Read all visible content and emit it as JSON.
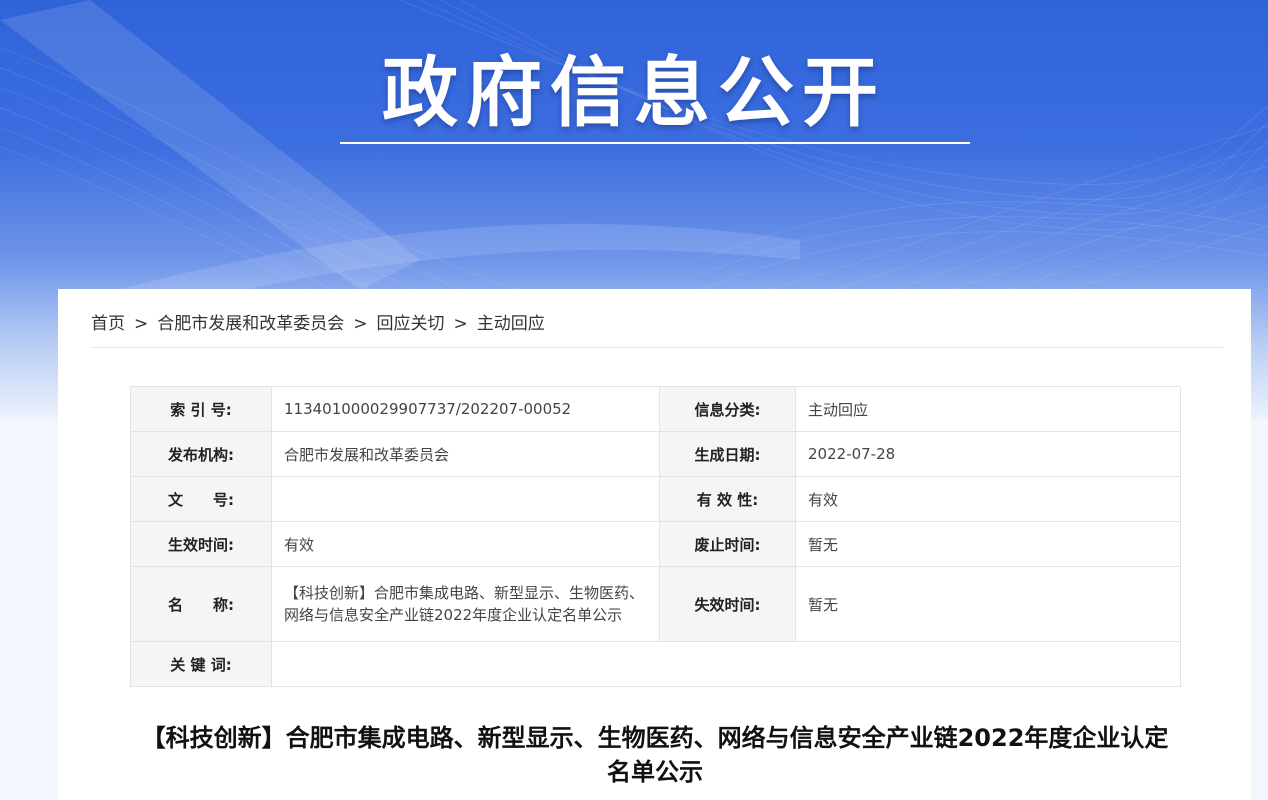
{
  "banner": {
    "title": "政府信息公开"
  },
  "breadcrumb": {
    "items": [
      "首页",
      "合肥市发展和改革委员会",
      "回应关切",
      "主动回应"
    ],
    "separator": ">"
  },
  "meta": {
    "index_label": "索 引 号:",
    "index_value": "113401000029907737/202207-00052",
    "category_label": "信息分类:",
    "category_value": "主动回应",
    "publisher_label": "发布机构:",
    "publisher_value": "合肥市发展和改革委员会",
    "date_label": "生成日期:",
    "date_value": "2022-07-28",
    "docno_label": "文　　号:",
    "docno_value": "",
    "validity_label": "有 效 性:",
    "validity_value": "有效",
    "effective_label": "生效时间:",
    "effective_value": "有效",
    "abolish_label": "废止时间:",
    "abolish_value": "暂无",
    "name_label": "名　　称:",
    "name_value": "【科技创新】合肥市集成电路、新型显示、生物医药、网络与信息安全产业链2022年度企业认定名单公示",
    "expire_label": "失效时间:",
    "expire_value": "暂无",
    "keywords_label": "关 键 词:",
    "keywords_value": ""
  },
  "document": {
    "title": "【科技创新】合肥市集成电路、新型显示、生物医药、网络与信息安全产业链2022年度企业认定名单公示"
  },
  "colors": {
    "banner_top": "#2f63d8",
    "label_bg": "#f5f5f5",
    "border": "#e3e3e3"
  }
}
